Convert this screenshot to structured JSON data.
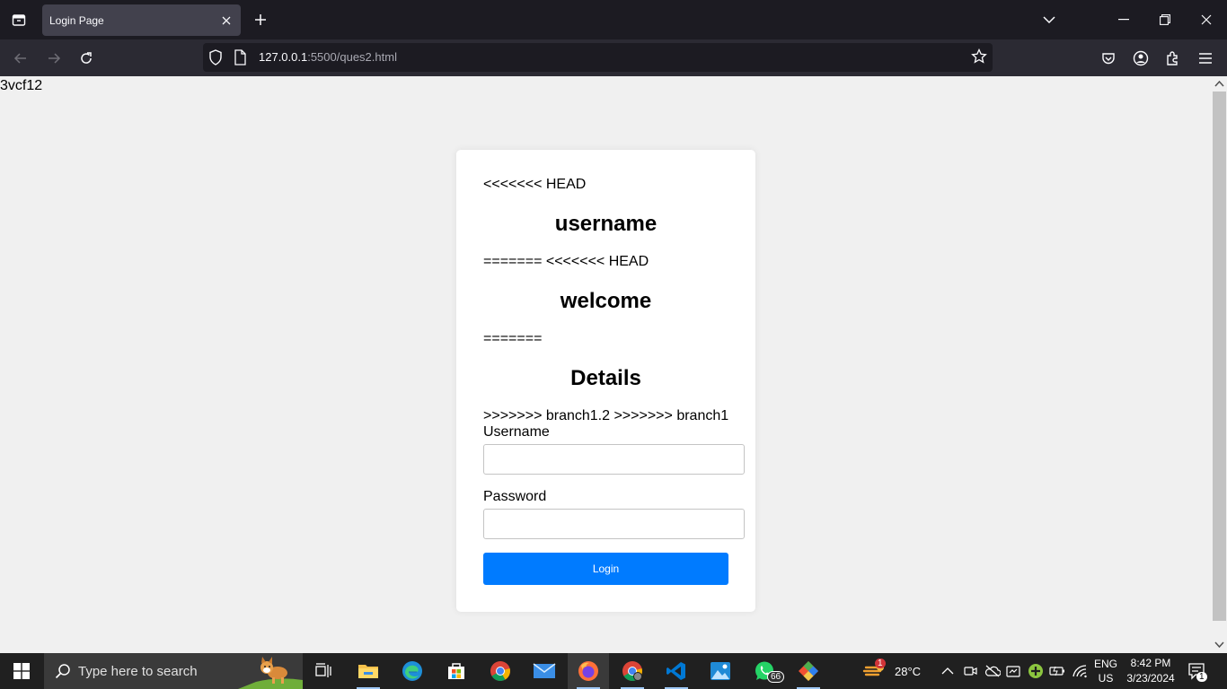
{
  "browser": {
    "tab_title": "Login Page",
    "url_host": "127.0.0.1",
    "url_rest": ":5500/ques2.html"
  },
  "page": {
    "stray_text": "3vcf12",
    "marker_head_1": "<<<<<<< HEAD",
    "heading_username": "username",
    "marker_eq_head": "======= <<<<<<< HEAD",
    "heading_welcome": "welcome",
    "marker_eq": "=======",
    "heading_details": "Details",
    "marker_branches": ">>>>>>> branch1.2 >>>>>>> branch1",
    "username_label": "Username",
    "password_label": "Password",
    "login_button": "Login"
  },
  "taskbar": {
    "search_placeholder": "Type here to search",
    "whatsapp_badge": "66",
    "weather_badge": "1",
    "temperature": "28°C",
    "lang": "ENG",
    "region": "US",
    "time": "8:42 PM",
    "date": "3/23/2024",
    "notification_count": "1"
  }
}
